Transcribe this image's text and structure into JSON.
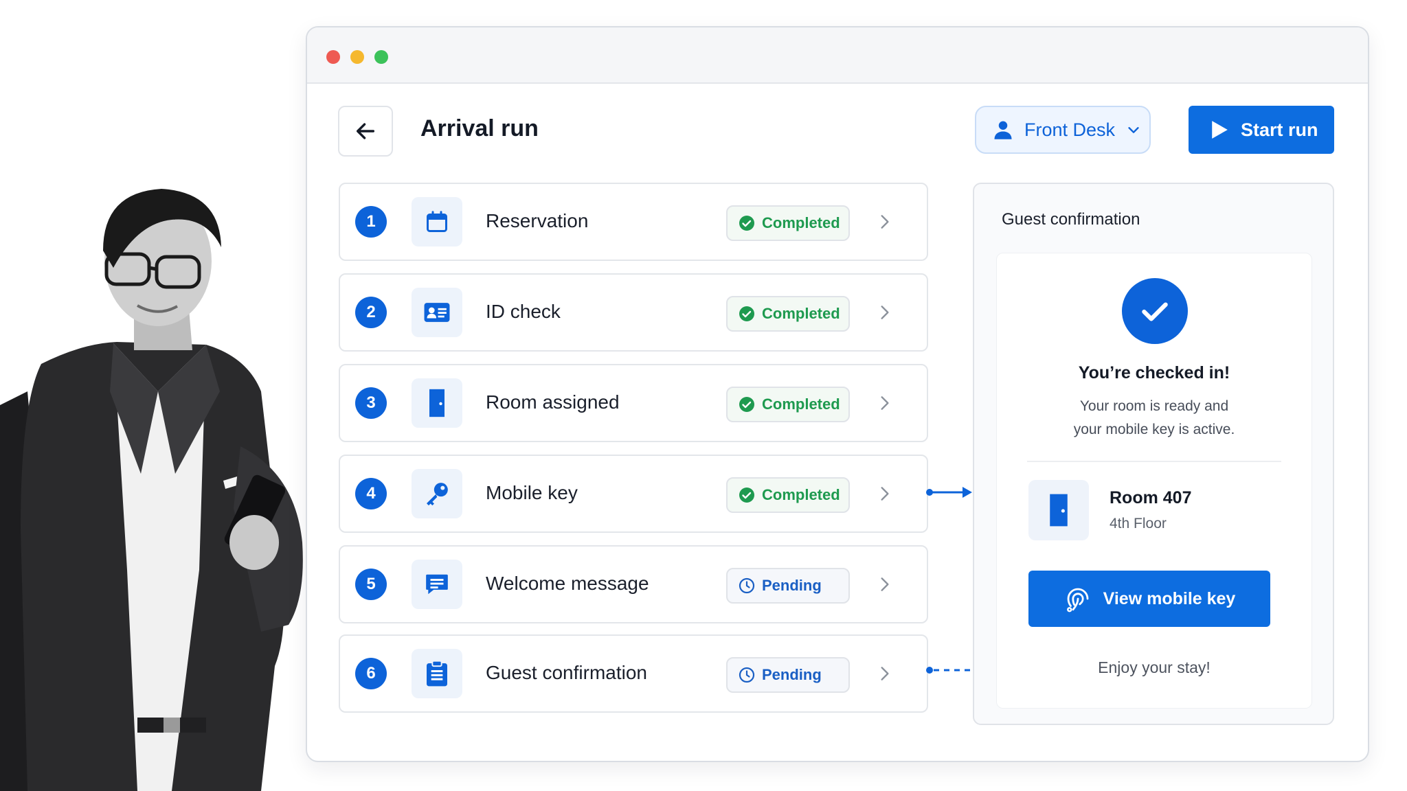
{
  "page": {
    "title": "Arrival run",
    "role_label": "Front Desk",
    "start_label": "Start run"
  },
  "steps": [
    {
      "number": "1",
      "label": "Reservation",
      "status": "Completed",
      "icon": "calendar-icon"
    },
    {
      "number": "2",
      "label": "ID check",
      "status": "Completed",
      "icon": "id-card-icon"
    },
    {
      "number": "3",
      "label": "Room assigned",
      "status": "Completed",
      "icon": "door-icon"
    },
    {
      "number": "4",
      "label": "Mobile key",
      "status": "Completed",
      "icon": "key-icon"
    },
    {
      "number": "5",
      "label": "Welcome message",
      "status": "Pending",
      "icon": "message-icon"
    },
    {
      "number": "6",
      "label": "Guest confirmation",
      "status": "Pending",
      "icon": "clipboard-icon"
    }
  ],
  "panel": {
    "title": "Guest confirmation",
    "heading": "You’re checked in!",
    "message_line1": "Your room is ready and",
    "message_line2": "your mobile key is active.",
    "room_number": "Room 407",
    "room_floor": "4th Floor",
    "button_label": "View mobile key",
    "footer": "Enjoy your stay!"
  },
  "colors": {
    "accent": "#0d6de0",
    "completed": "#1e9a4f",
    "pending": "#1a5fc4"
  }
}
